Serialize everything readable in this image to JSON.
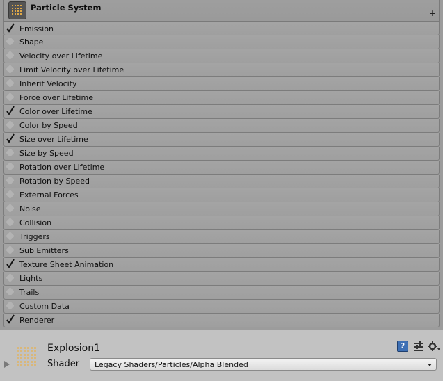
{
  "particle_system": {
    "title": "Particle System",
    "add_symbol": "+",
    "modules": [
      {
        "label": "Emission",
        "enabled": true
      },
      {
        "label": "Shape",
        "enabled": false
      },
      {
        "label": "Velocity over Lifetime",
        "enabled": false
      },
      {
        "label": "Limit Velocity over Lifetime",
        "enabled": false
      },
      {
        "label": "Inherit Velocity",
        "enabled": false
      },
      {
        "label": "Force over Lifetime",
        "enabled": false
      },
      {
        "label": "Color over Lifetime",
        "enabled": true
      },
      {
        "label": "Color by Speed",
        "enabled": false
      },
      {
        "label": "Size over Lifetime",
        "enabled": true
      },
      {
        "label": "Size by Speed",
        "enabled": false
      },
      {
        "label": "Rotation over Lifetime",
        "enabled": false
      },
      {
        "label": "Rotation by Speed",
        "enabled": false
      },
      {
        "label": "External Forces",
        "enabled": false
      },
      {
        "label": "Noise",
        "enabled": false
      },
      {
        "label": "Collision",
        "enabled": false
      },
      {
        "label": "Triggers",
        "enabled": false
      },
      {
        "label": "Sub Emitters",
        "enabled": false
      },
      {
        "label": "Texture Sheet Animation",
        "enabled": true
      },
      {
        "label": "Lights",
        "enabled": false
      },
      {
        "label": "Trails",
        "enabled": false
      },
      {
        "label": "Custom Data",
        "enabled": false
      },
      {
        "label": "Renderer",
        "enabled": true
      }
    ]
  },
  "material": {
    "name": "Explosion1",
    "shader_label": "Shader",
    "shader_value": "Legacy Shaders/Particles/Alpha Blended",
    "help_symbol": "?"
  },
  "colors": {
    "panel": "#9c9c9c",
    "row": "#a4a4a4",
    "help_icon": "#3d6fb4"
  }
}
